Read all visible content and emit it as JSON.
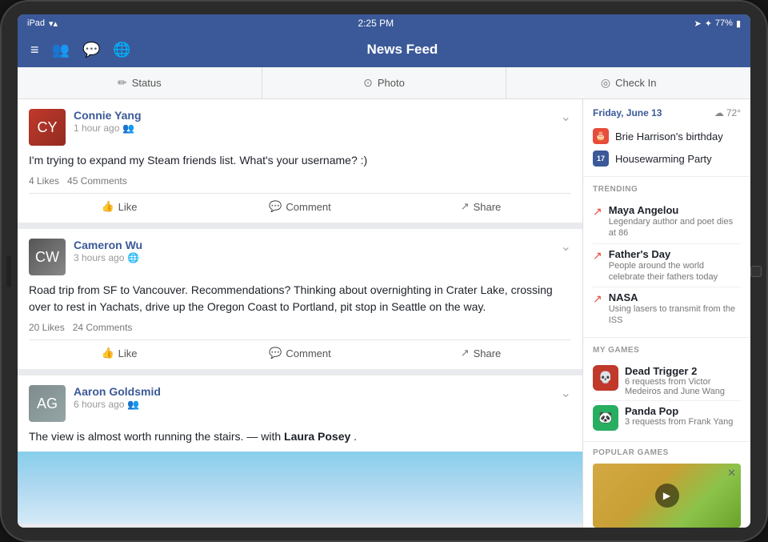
{
  "device": {
    "type": "iPad"
  },
  "status_bar": {
    "left": "iPad",
    "time": "2:25 PM",
    "battery": "77%",
    "signal_icon": "wifi"
  },
  "nav_bar": {
    "title": "News Feed",
    "menu_icon": "≡",
    "icons": [
      "friends",
      "chat",
      "globe"
    ]
  },
  "action_bar": {
    "items": [
      {
        "label": "Status",
        "icon": "✏️"
      },
      {
        "label": "Photo",
        "icon": "📷"
      },
      {
        "label": "Check In",
        "icon": "📍"
      }
    ]
  },
  "posts": [
    {
      "id": "post1",
      "author": "Connie Yang",
      "time": "1 hour ago",
      "privacy": "friends",
      "text": "I'm trying to expand my Steam friends list. What's your username? :)",
      "likes": "4 Likes",
      "comments": "45 Comments",
      "actions": [
        "Like",
        "Comment",
        "Share"
      ]
    },
    {
      "id": "post2",
      "author": "Cameron Wu",
      "time": "3 hours ago",
      "privacy": "public",
      "text": "Road trip from SF to Vancouver. Recommendations? Thinking about overnighting in Crater Lake, crossing over to rest in Yachats, drive up the Oregon Coast to Portland, pit stop in Seattle on the way.",
      "likes": "20 Likes",
      "comments": "24 Comments",
      "actions": [
        "Like",
        "Comment",
        "Share"
      ]
    },
    {
      "id": "post3",
      "author": "Aaron Goldsmid",
      "time": "6 hours ago",
      "privacy": "friends",
      "text_before": "The view is almost worth running the stairs. — with",
      "mention": "Laura Posey",
      "text_after": ".",
      "has_image": true
    }
  ],
  "sidebar": {
    "date": "Friday, June 13",
    "weather": "72°",
    "events": [
      {
        "type": "birthday",
        "label": "Brie Harrison's birthday",
        "icon_text": "🎂"
      },
      {
        "type": "calendar",
        "label": "Housewarming Party",
        "icon_text": "17"
      }
    ],
    "trending_title": "TRENDING",
    "trending": [
      {
        "name": "Maya Angelou",
        "desc": "Legendary author and poet dies at 86"
      },
      {
        "name": "Father's Day",
        "desc": "People around the world celebrate their fathers today"
      },
      {
        "name": "NASA",
        "desc": "Using lasers to transmit from the ISS"
      }
    ],
    "my_games_title": "MY GAMES",
    "games": [
      {
        "name": "Dead Trigger 2",
        "desc": "6 requests from Victor Medeiros and June Wang",
        "icon": "DT2"
      },
      {
        "name": "Panda Pop",
        "desc": "3 requests from Frank Yang",
        "icon": "🐼"
      }
    ],
    "popular_games_title": "POPULAR GAMES"
  }
}
